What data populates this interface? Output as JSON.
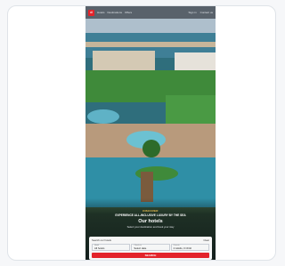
{
  "nav": {
    "logo_text": "d",
    "links": [
      "Hotels",
      "Destinations",
      "Offers"
    ],
    "right_links": [
      "Sign in",
      "Contact us"
    ]
  },
  "hero": {
    "eyebrow": "DISCOVER",
    "headline": "EXPERIENCE ALL-INCLUSIVE LUXURY BY THE SEA",
    "title": "Our hotels",
    "subtitle": "Select your destination and book your stay"
  },
  "search": {
    "header_left": "Search our hotels",
    "header_right": "Clear",
    "fields": [
      {
        "label": "Hotel",
        "value": "All hotels"
      },
      {
        "label": "Check-in",
        "value": "Select date"
      },
      {
        "label": "Guests",
        "value": "2 Adults, 0 Child"
      }
    ],
    "button_label": "SEARCH"
  },
  "colors": {
    "accent": "#e3242b",
    "sea": "#2f6e7c",
    "pool": "#5fb2c6",
    "lawn": "#3f8a3a"
  }
}
